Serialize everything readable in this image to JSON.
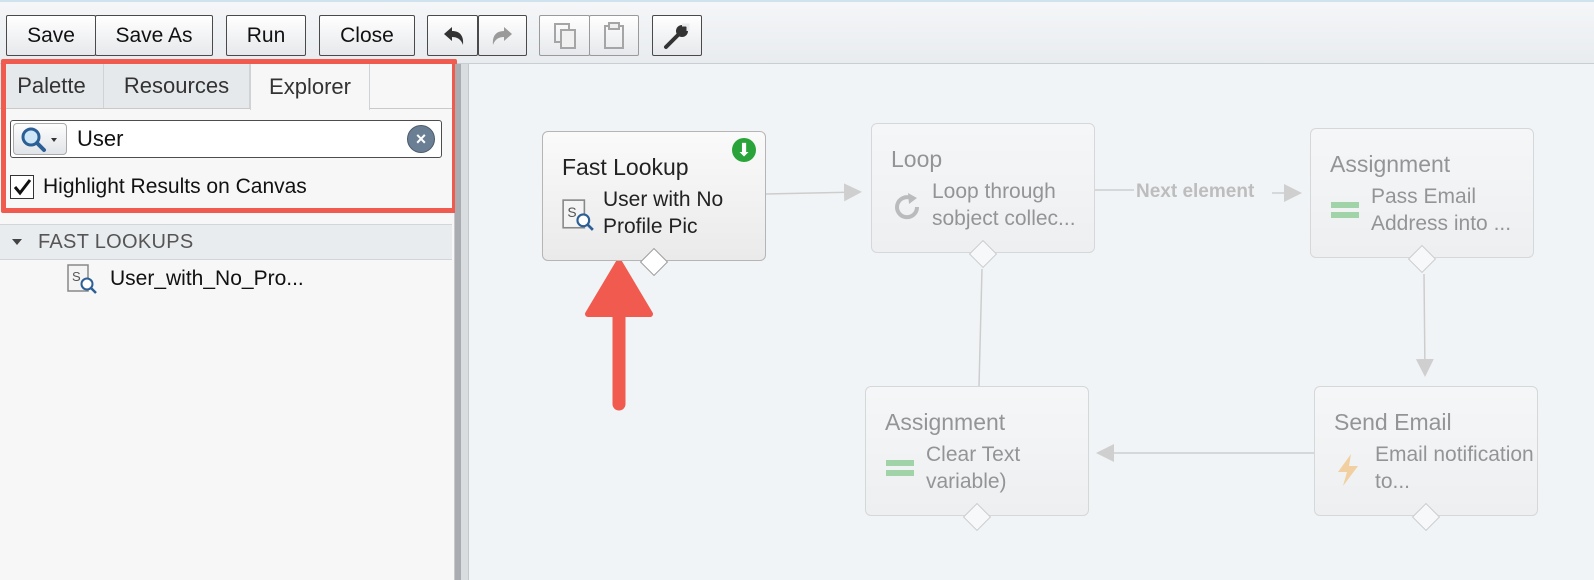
{
  "toolbar": {
    "save": "Save",
    "save_as": "Save As",
    "run": "Run",
    "close": "Close",
    "icons": [
      "undo-icon",
      "redo-icon",
      "copy-icon",
      "paste-icon",
      "wrench-icon"
    ]
  },
  "left_panel": {
    "tabs": [
      {
        "label": "Palette"
      },
      {
        "label": "Resources"
      },
      {
        "label": "Explorer"
      }
    ],
    "active_tab": "Explorer",
    "search": {
      "value": "User"
    },
    "highlight_checkbox": {
      "label": "Highlight Results on Canvas",
      "checked": true
    },
    "section": {
      "label": "FAST LOOKUPS"
    },
    "items": [
      {
        "label": "User_with_No_Pro..."
      }
    ]
  },
  "canvas": {
    "nodes": [
      {
        "type": "Fast Lookup",
        "desc": "User with No Profile Pic",
        "highlighted": true
      },
      {
        "type": "Loop",
        "desc": "Loop through sobject collec..."
      },
      {
        "type": "Assignment",
        "desc": "Pass Email Address into ..."
      },
      {
        "type": "Assignment",
        "desc": "Clear Text variable)"
      },
      {
        "type": "Send Email",
        "desc": "Email notification to..."
      }
    ],
    "edge_label": "Next element"
  },
  "colors": {
    "highlight": "#f05a4f",
    "add_badge": "#2aa43a",
    "canvas_bg": "#f1f4f6"
  }
}
